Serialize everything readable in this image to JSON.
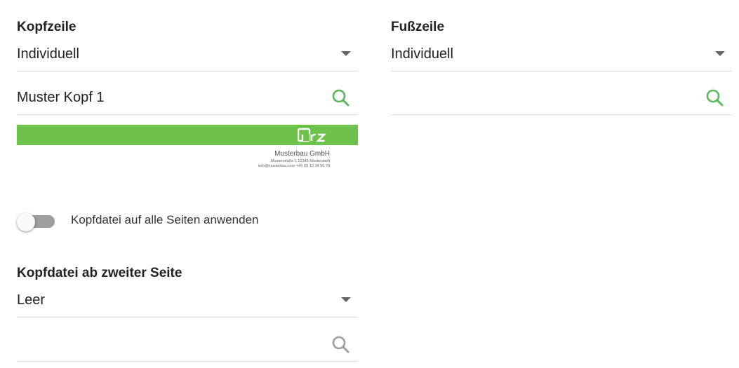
{
  "header": {
    "label": "Kopfzeile",
    "select_value": "Individuell",
    "file_value": "Muster Kopf 1",
    "preview": {
      "company": "Musterbau GmbH",
      "address": "Musterstraße 1  12345 Musterstadt",
      "contact": "info@musterbau.com  +49 (0) 12 34 56 78"
    }
  },
  "footer": {
    "label": "Fußzeile",
    "select_value": "Individuell",
    "file_value": ""
  },
  "apply_all": {
    "label": "Kopfdatei auf alle Seiten anwenden",
    "enabled": false
  },
  "second_page": {
    "label": "Kopfdatei ab zweiter Seite",
    "select_value": "Leer",
    "file_value": ""
  },
  "colors": {
    "accent": "#6cc24a",
    "search_active": "#5cb85c",
    "search_inactive": "#9e9e9e",
    "toggle_off": "#9e9e9e"
  }
}
